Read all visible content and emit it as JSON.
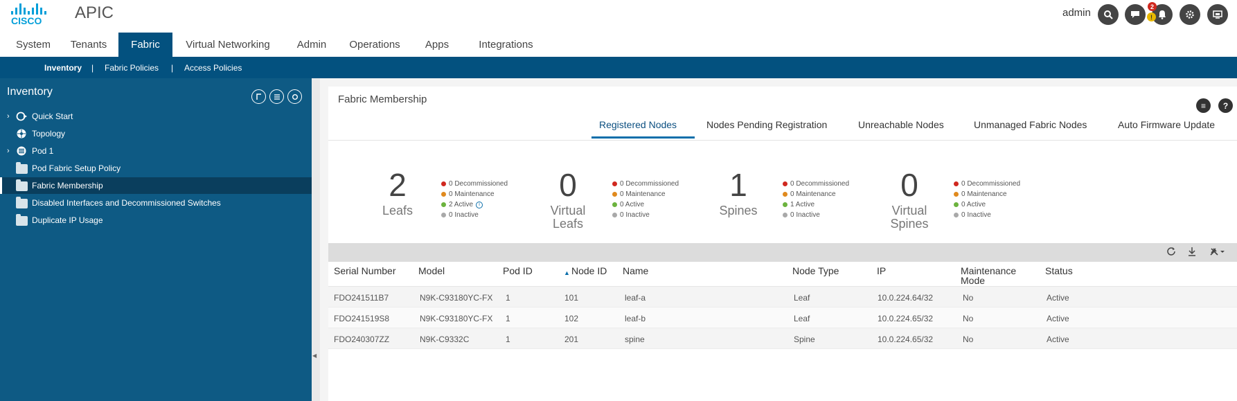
{
  "header": {
    "brand": "CISCO",
    "app_title": "APIC",
    "user": "admin",
    "icons": [
      "search-icon",
      "feedback-icon",
      "bell-icon",
      "gear-icon",
      "system-tools-icon"
    ],
    "alert_badges": {
      "critical": "2",
      "warning": "!"
    }
  },
  "main_nav": {
    "tabs": [
      {
        "label": "System"
      },
      {
        "label": "Tenants"
      },
      {
        "label": "Fabric"
      },
      {
        "label": "Virtual Networking"
      },
      {
        "label": "Admin"
      },
      {
        "label": "Operations"
      },
      {
        "label": "Apps"
      },
      {
        "label": "Integrations"
      }
    ],
    "active": "Fabric"
  },
  "sub_nav": {
    "items": [
      {
        "label": "Inventory"
      },
      {
        "label": "|"
      },
      {
        "label": "Fabric Policies"
      },
      {
        "label": "|"
      },
      {
        "label": "Access Policies"
      }
    ],
    "active": "Inventory"
  },
  "left_panel": {
    "title": "Inventory",
    "tree": [
      {
        "label": "Quick Start",
        "icon": "quick-start-icon",
        "expandable": true
      },
      {
        "label": "Topology",
        "icon": "topology-icon",
        "expandable": false
      },
      {
        "label": "Pod 1",
        "icon": "pod-icon",
        "expandable": true
      },
      {
        "label": "Pod Fabric Setup Policy",
        "icon": "folder-icon",
        "expandable": false
      },
      {
        "label": "Fabric Membership",
        "icon": "folder-icon",
        "expandable": false,
        "selected": true
      },
      {
        "label": "Disabled Interfaces and Decommissioned Switches",
        "icon": "folder-icon",
        "expandable": false
      },
      {
        "label": "Duplicate IP Usage",
        "icon": "folder-icon",
        "expandable": false
      }
    ]
  },
  "content": {
    "title": "Fabric Membership",
    "tabs": [
      {
        "label": "Registered Nodes"
      },
      {
        "label": "Nodes Pending Registration"
      },
      {
        "label": "Unreachable Nodes"
      },
      {
        "label": "Unmanaged Fabric Nodes"
      },
      {
        "label": "Auto Firmware Update"
      }
    ],
    "active_tab": "Registered Nodes",
    "stats": [
      {
        "count": "2",
        "label": "Leafs",
        "label2": "",
        "decommissioned": "0 Decommissioned",
        "maintenance": "0 Maintenance",
        "active": "2 Active",
        "inactive": "0 Inactive"
      },
      {
        "count": "0",
        "label": "Virtual",
        "label2": "Leafs",
        "decommissioned": "0 Decommissioned",
        "maintenance": "0 Maintenance",
        "active": "0 Active",
        "inactive": "0 Inactive"
      },
      {
        "count": "1",
        "label": "Spines",
        "label2": "",
        "decommissioned": "0 Decommissioned",
        "maintenance": "0 Maintenance",
        "active": "1 Active",
        "inactive": "0 Inactive"
      },
      {
        "count": "0",
        "label": "Virtual",
        "label2": "Spines",
        "decommissioned": "0 Decommissioned",
        "maintenance": "0 Maintenance",
        "active": "0 Active",
        "inactive": "0 Inactive"
      }
    ],
    "status_colors": {
      "decommissioned": "#d0281f",
      "maintenance": "#e08a1e",
      "active": "#6cb33e",
      "inactive": "#a9a9a9"
    },
    "table": {
      "columns": [
        "Serial Number",
        "Model",
        "Pod ID",
        "Node ID",
        "Name",
        "Node Type",
        "IP",
        "Maintenance",
        "Status"
      ],
      "column_line2": {
        "maintenance": "Mode"
      },
      "sort_indicator": "▲",
      "rows": [
        [
          "FDO241511B7",
          "N9K-C93180YC-FX",
          "1",
          "101",
          "leaf-a",
          "Leaf",
          "10.0.224.64/32",
          "No",
          "Active"
        ],
        [
          "FDO241519S8",
          "N9K-C93180YC-FX",
          "1",
          "102",
          "leaf-b",
          "Leaf",
          "10.0.224.65/32",
          "No",
          "Active"
        ],
        [
          "FDO240307ZZ",
          "N9K-C9332C",
          "1",
          "201",
          "spine",
          "Spine",
          "10.0.224.65/32",
          "No",
          "Active"
        ]
      ]
    }
  }
}
